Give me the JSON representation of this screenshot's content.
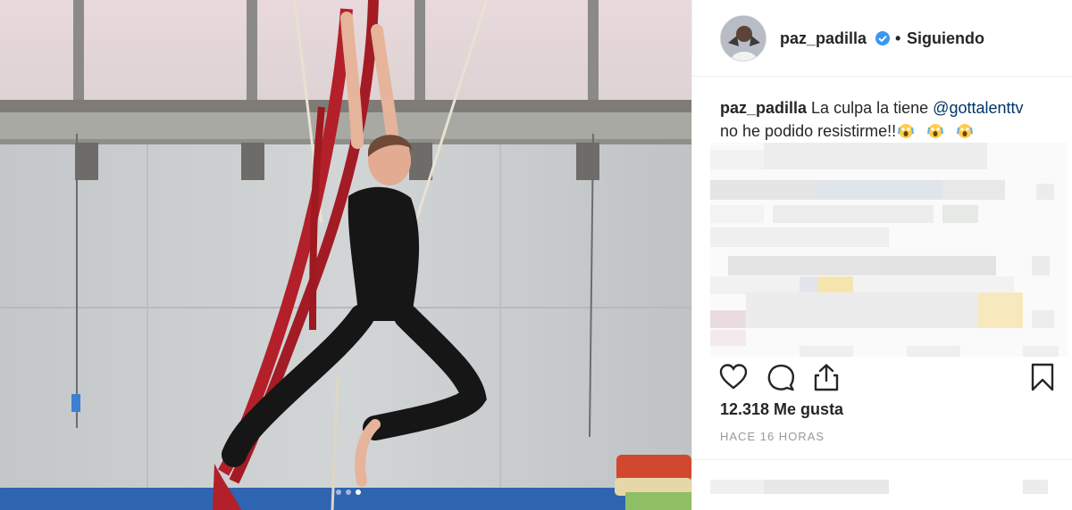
{
  "post": {
    "username": "paz_padilla",
    "separator": "•",
    "follow_status": "Siguiendo",
    "caption_user": "paz_padilla",
    "caption_text_1": "La culpa la tiene",
    "caption_mention": "@gottalenttv",
    "caption_text_2": "no he podido resistirme!!",
    "likes": "12.318 Me gusta",
    "time_ago": "HACE 16 HORAS"
  },
  "carousel": {
    "total": 3,
    "active": 3
  },
  "icons": {
    "like": "heart-icon",
    "comment": "comment-bubble-icon",
    "share": "share-icon",
    "save": "bookmark-icon",
    "verified": "verified-badge-icon",
    "emoji": "screaming-face-emoji"
  },
  "colors": {
    "text": "#262626",
    "secondary": "#999999",
    "mention": "#003569",
    "verified": "#3897f0",
    "silk": "#b3202a"
  }
}
